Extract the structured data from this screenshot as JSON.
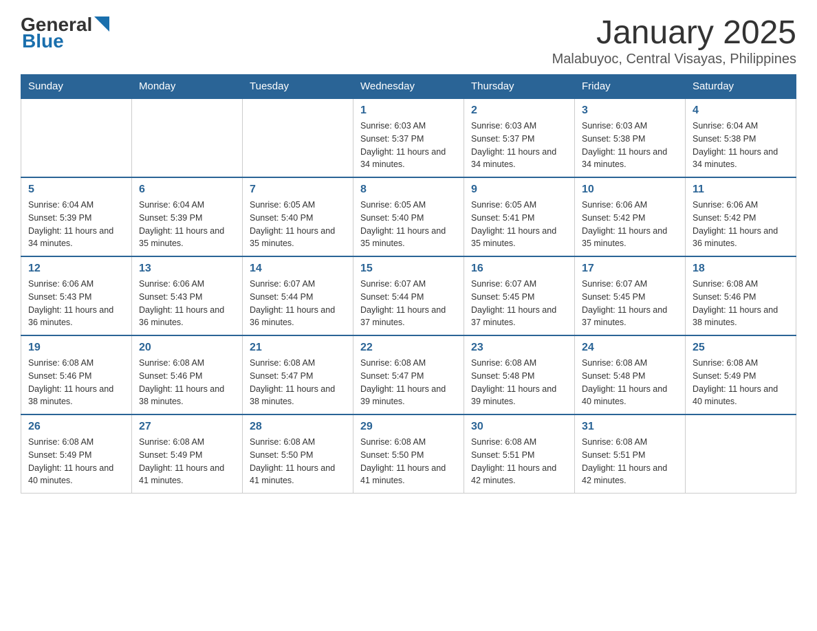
{
  "header": {
    "logo_general": "General",
    "logo_blue": "Blue",
    "month_year": "January 2025",
    "location": "Malabuyoc, Central Visayas, Philippines"
  },
  "days_of_week": [
    "Sunday",
    "Monday",
    "Tuesday",
    "Wednesday",
    "Thursday",
    "Friday",
    "Saturday"
  ],
  "weeks": [
    [
      {
        "day": "",
        "sunrise": "",
        "sunset": "",
        "daylight": ""
      },
      {
        "day": "",
        "sunrise": "",
        "sunset": "",
        "daylight": ""
      },
      {
        "day": "",
        "sunrise": "",
        "sunset": "",
        "daylight": ""
      },
      {
        "day": "1",
        "sunrise": "Sunrise: 6:03 AM",
        "sunset": "Sunset: 5:37 PM",
        "daylight": "Daylight: 11 hours and 34 minutes."
      },
      {
        "day": "2",
        "sunrise": "Sunrise: 6:03 AM",
        "sunset": "Sunset: 5:37 PM",
        "daylight": "Daylight: 11 hours and 34 minutes."
      },
      {
        "day": "3",
        "sunrise": "Sunrise: 6:03 AM",
        "sunset": "Sunset: 5:38 PM",
        "daylight": "Daylight: 11 hours and 34 minutes."
      },
      {
        "day": "4",
        "sunrise": "Sunrise: 6:04 AM",
        "sunset": "Sunset: 5:38 PM",
        "daylight": "Daylight: 11 hours and 34 minutes."
      }
    ],
    [
      {
        "day": "5",
        "sunrise": "Sunrise: 6:04 AM",
        "sunset": "Sunset: 5:39 PM",
        "daylight": "Daylight: 11 hours and 34 minutes."
      },
      {
        "day": "6",
        "sunrise": "Sunrise: 6:04 AM",
        "sunset": "Sunset: 5:39 PM",
        "daylight": "Daylight: 11 hours and 35 minutes."
      },
      {
        "day": "7",
        "sunrise": "Sunrise: 6:05 AM",
        "sunset": "Sunset: 5:40 PM",
        "daylight": "Daylight: 11 hours and 35 minutes."
      },
      {
        "day": "8",
        "sunrise": "Sunrise: 6:05 AM",
        "sunset": "Sunset: 5:40 PM",
        "daylight": "Daylight: 11 hours and 35 minutes."
      },
      {
        "day": "9",
        "sunrise": "Sunrise: 6:05 AM",
        "sunset": "Sunset: 5:41 PM",
        "daylight": "Daylight: 11 hours and 35 minutes."
      },
      {
        "day": "10",
        "sunrise": "Sunrise: 6:06 AM",
        "sunset": "Sunset: 5:42 PM",
        "daylight": "Daylight: 11 hours and 35 minutes."
      },
      {
        "day": "11",
        "sunrise": "Sunrise: 6:06 AM",
        "sunset": "Sunset: 5:42 PM",
        "daylight": "Daylight: 11 hours and 36 minutes."
      }
    ],
    [
      {
        "day": "12",
        "sunrise": "Sunrise: 6:06 AM",
        "sunset": "Sunset: 5:43 PM",
        "daylight": "Daylight: 11 hours and 36 minutes."
      },
      {
        "day": "13",
        "sunrise": "Sunrise: 6:06 AM",
        "sunset": "Sunset: 5:43 PM",
        "daylight": "Daylight: 11 hours and 36 minutes."
      },
      {
        "day": "14",
        "sunrise": "Sunrise: 6:07 AM",
        "sunset": "Sunset: 5:44 PM",
        "daylight": "Daylight: 11 hours and 36 minutes."
      },
      {
        "day": "15",
        "sunrise": "Sunrise: 6:07 AM",
        "sunset": "Sunset: 5:44 PM",
        "daylight": "Daylight: 11 hours and 37 minutes."
      },
      {
        "day": "16",
        "sunrise": "Sunrise: 6:07 AM",
        "sunset": "Sunset: 5:45 PM",
        "daylight": "Daylight: 11 hours and 37 minutes."
      },
      {
        "day": "17",
        "sunrise": "Sunrise: 6:07 AM",
        "sunset": "Sunset: 5:45 PM",
        "daylight": "Daylight: 11 hours and 37 minutes."
      },
      {
        "day": "18",
        "sunrise": "Sunrise: 6:08 AM",
        "sunset": "Sunset: 5:46 PM",
        "daylight": "Daylight: 11 hours and 38 minutes."
      }
    ],
    [
      {
        "day": "19",
        "sunrise": "Sunrise: 6:08 AM",
        "sunset": "Sunset: 5:46 PM",
        "daylight": "Daylight: 11 hours and 38 minutes."
      },
      {
        "day": "20",
        "sunrise": "Sunrise: 6:08 AM",
        "sunset": "Sunset: 5:46 PM",
        "daylight": "Daylight: 11 hours and 38 minutes."
      },
      {
        "day": "21",
        "sunrise": "Sunrise: 6:08 AM",
        "sunset": "Sunset: 5:47 PM",
        "daylight": "Daylight: 11 hours and 38 minutes."
      },
      {
        "day": "22",
        "sunrise": "Sunrise: 6:08 AM",
        "sunset": "Sunset: 5:47 PM",
        "daylight": "Daylight: 11 hours and 39 minutes."
      },
      {
        "day": "23",
        "sunrise": "Sunrise: 6:08 AM",
        "sunset": "Sunset: 5:48 PM",
        "daylight": "Daylight: 11 hours and 39 minutes."
      },
      {
        "day": "24",
        "sunrise": "Sunrise: 6:08 AM",
        "sunset": "Sunset: 5:48 PM",
        "daylight": "Daylight: 11 hours and 40 minutes."
      },
      {
        "day": "25",
        "sunrise": "Sunrise: 6:08 AM",
        "sunset": "Sunset: 5:49 PM",
        "daylight": "Daylight: 11 hours and 40 minutes."
      }
    ],
    [
      {
        "day": "26",
        "sunrise": "Sunrise: 6:08 AM",
        "sunset": "Sunset: 5:49 PM",
        "daylight": "Daylight: 11 hours and 40 minutes."
      },
      {
        "day": "27",
        "sunrise": "Sunrise: 6:08 AM",
        "sunset": "Sunset: 5:49 PM",
        "daylight": "Daylight: 11 hours and 41 minutes."
      },
      {
        "day": "28",
        "sunrise": "Sunrise: 6:08 AM",
        "sunset": "Sunset: 5:50 PM",
        "daylight": "Daylight: 11 hours and 41 minutes."
      },
      {
        "day": "29",
        "sunrise": "Sunrise: 6:08 AM",
        "sunset": "Sunset: 5:50 PM",
        "daylight": "Daylight: 11 hours and 41 minutes."
      },
      {
        "day": "30",
        "sunrise": "Sunrise: 6:08 AM",
        "sunset": "Sunset: 5:51 PM",
        "daylight": "Daylight: 11 hours and 42 minutes."
      },
      {
        "day": "31",
        "sunrise": "Sunrise: 6:08 AM",
        "sunset": "Sunset: 5:51 PM",
        "daylight": "Daylight: 11 hours and 42 minutes."
      },
      {
        "day": "",
        "sunrise": "",
        "sunset": "",
        "daylight": ""
      }
    ]
  ]
}
